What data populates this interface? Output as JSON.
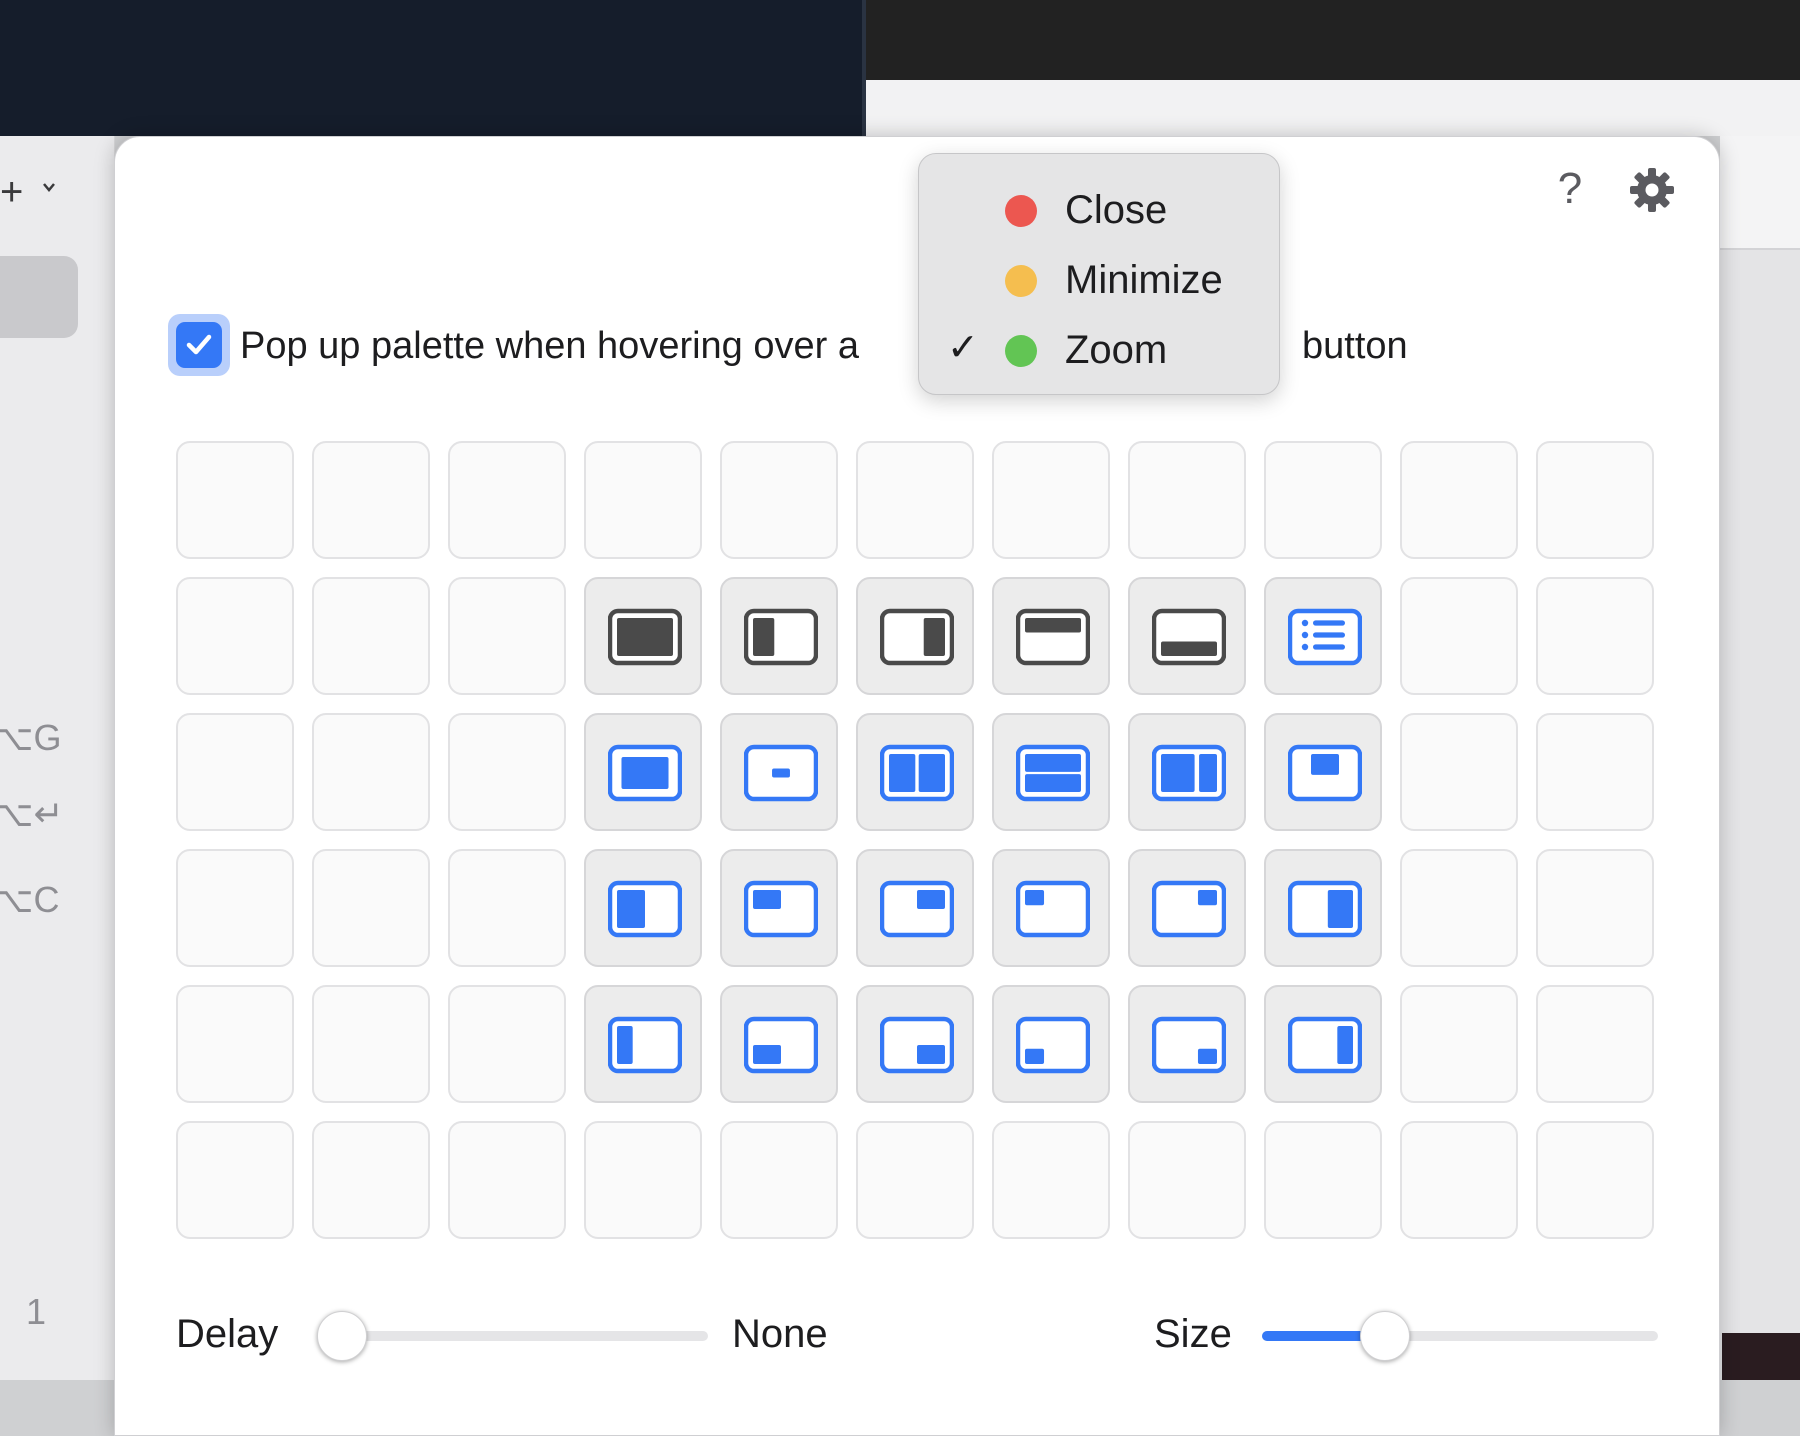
{
  "left_panel": {
    "shortcut_keys": [
      "⌥G",
      "⌥↵",
      "⌥C"
    ],
    "number": "1"
  },
  "toolbar": {
    "help_label": "?",
    "settings_icon": "gear-icon"
  },
  "option": {
    "label_start": "Pop up palette when hovering over a",
    "label_end": "button",
    "checked": true
  },
  "menu": {
    "items": [
      {
        "label": "Close",
        "color": "#ec5750",
        "checked": false
      },
      {
        "label": "Minimize",
        "color": "#f5be4f",
        "checked": false
      },
      {
        "label": "Zoom",
        "color": "#62c554",
        "checked": true
      }
    ],
    "check_glyph": "✓"
  },
  "palette": {
    "rows": 6,
    "cols": 11,
    "cells": [
      {
        "row": 1,
        "col": 3,
        "icon": "fullscreen-icon",
        "style": "dark"
      },
      {
        "row": 1,
        "col": 4,
        "icon": "left-half-icon",
        "style": "dark"
      },
      {
        "row": 1,
        "col": 5,
        "icon": "right-half-icon",
        "style": "dark"
      },
      {
        "row": 1,
        "col": 6,
        "icon": "top-half-icon",
        "style": "dark"
      },
      {
        "row": 1,
        "col": 7,
        "icon": "bottom-half-icon",
        "style": "dark"
      },
      {
        "row": 1,
        "col": 8,
        "icon": "list-icon",
        "style": "blue"
      },
      {
        "row": 2,
        "col": 3,
        "icon": "maximize-icon",
        "style": "blue"
      },
      {
        "row": 2,
        "col": 4,
        "icon": "center-small-icon",
        "style": "blue"
      },
      {
        "row": 2,
        "col": 5,
        "icon": "two-columns-icon",
        "style": "blue"
      },
      {
        "row": 2,
        "col": 6,
        "icon": "two-rows-icon",
        "style": "blue"
      },
      {
        "row": 2,
        "col": 7,
        "icon": "wide-left-icon",
        "style": "blue"
      },
      {
        "row": 2,
        "col": 8,
        "icon": "center-top-icon",
        "style": "blue"
      },
      {
        "row": 3,
        "col": 3,
        "icon": "left-third-icon",
        "style": "blue"
      },
      {
        "row": 3,
        "col": 4,
        "icon": "top-left-quarter-icon",
        "style": "blue"
      },
      {
        "row": 3,
        "col": 5,
        "icon": "top-right-quarter-icon",
        "style": "blue"
      },
      {
        "row": 3,
        "col": 6,
        "icon": "top-left-small-icon",
        "style": "blue"
      },
      {
        "row": 3,
        "col": 7,
        "icon": "top-right-small-icon",
        "style": "blue"
      },
      {
        "row": 3,
        "col": 8,
        "icon": "right-third-icon",
        "style": "blue"
      },
      {
        "row": 4,
        "col": 3,
        "icon": "left-narrow-icon",
        "style": "blue"
      },
      {
        "row": 4,
        "col": 4,
        "icon": "bottom-left-quarter-icon",
        "style": "blue"
      },
      {
        "row": 4,
        "col": 5,
        "icon": "bottom-right-quarter-icon",
        "style": "blue"
      },
      {
        "row": 4,
        "col": 6,
        "icon": "bottom-left-small-icon",
        "style": "blue"
      },
      {
        "row": 4,
        "col": 7,
        "icon": "bottom-right-small-icon",
        "style": "blue"
      },
      {
        "row": 4,
        "col": 8,
        "icon": "right-narrow-icon",
        "style": "blue"
      }
    ]
  },
  "sliders": {
    "delay_label": "Delay",
    "delay_value_label": "None",
    "delay_value": 0,
    "size_label": "Size",
    "size_value": 0.31
  },
  "colors": {
    "accent": "#3478f6",
    "icon_dark": "#4a4a4a"
  }
}
